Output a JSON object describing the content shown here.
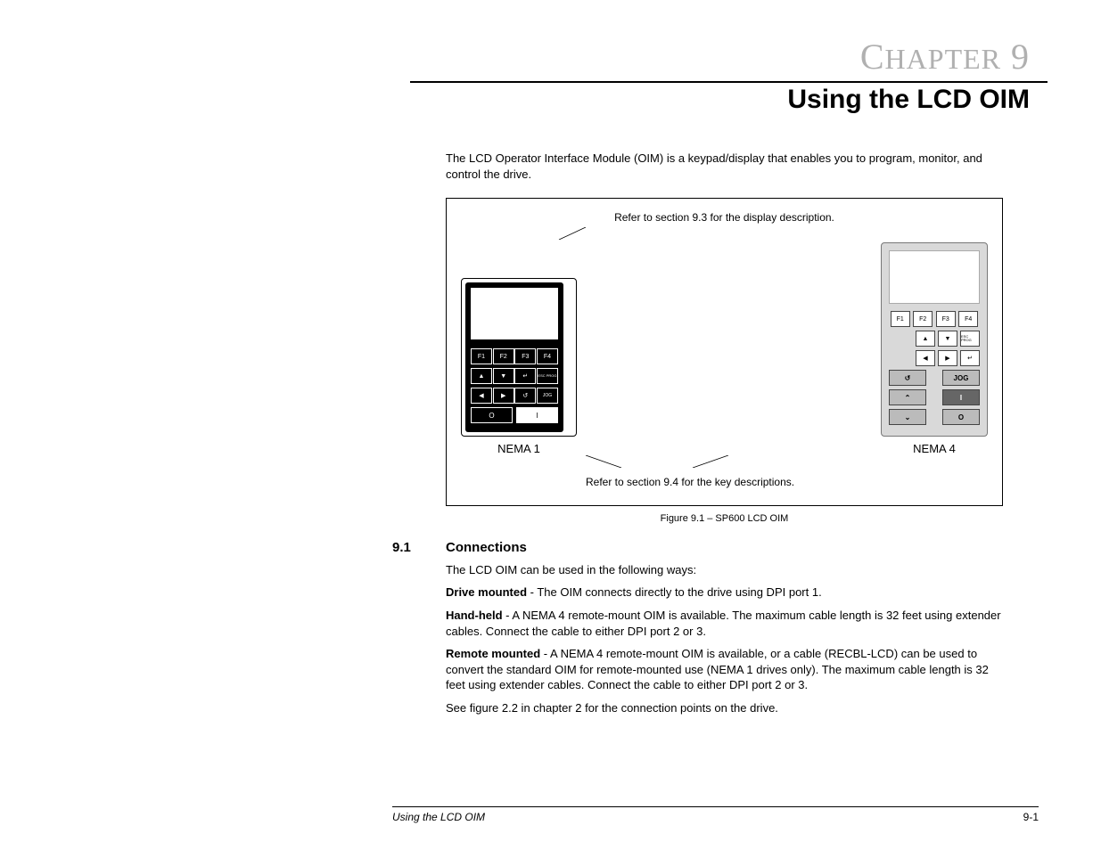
{
  "header": {
    "chapter_word": "C",
    "chapter_rest": "HAPTER",
    "chapter_num": "9",
    "title": "Using the LCD OIM"
  },
  "intro": "The LCD Operator Interface Module (OIM) is a keypad/display that enables you to program, monitor, and control the drive.",
  "figure": {
    "note_top": "Refer to section 9.3 for the display description.",
    "note_bottom": "Refer to section 9.4 for the key descriptions.",
    "label_left": "NEMA 1",
    "label_right": "NEMA 4",
    "caption": "Figure 9.1 – SP600 LCD OIM",
    "nema1_keys": {
      "f1": "F1",
      "f2": "F2",
      "f3": "F3",
      "f4": "F4",
      "esc": "ESC PROG",
      "jog": "JOG",
      "stop": "O",
      "start": "I"
    },
    "nema4_keys": {
      "f1": "F1",
      "f2": "F2",
      "f3": "F3",
      "f4": "F4",
      "esc": "ESC PROG",
      "jog": "JOG",
      "start": "I",
      "stop": "O"
    }
  },
  "section": {
    "num": "9.1",
    "title": "Connections",
    "intro": "The LCD OIM can be used in the following ways:",
    "paras": [
      {
        "lead": "Drive mounted",
        "text": " - The OIM connects directly to the drive using DPI port 1."
      },
      {
        "lead": "Hand-held",
        "text": " - A NEMA 4 remote-mount OIM is available. The maximum cable length is 32 feet using extender cables. Connect the cable to either DPI port 2 or 3."
      },
      {
        "lead": "Remote mounted",
        "text": " - A NEMA 4 remote-mount OIM is available, or a cable (RECBL-LCD) can be used to convert the standard OIM for remote-mounted use (NEMA 1 drives only). The maximum cable length is 32 feet using extender cables. Connect the cable to either DPI port 2 or 3."
      }
    ],
    "closing": "See figure 2.2 in chapter 2 for the connection points on the drive."
  },
  "footer": {
    "left": "Using the LCD OIM",
    "right": "9-1"
  }
}
